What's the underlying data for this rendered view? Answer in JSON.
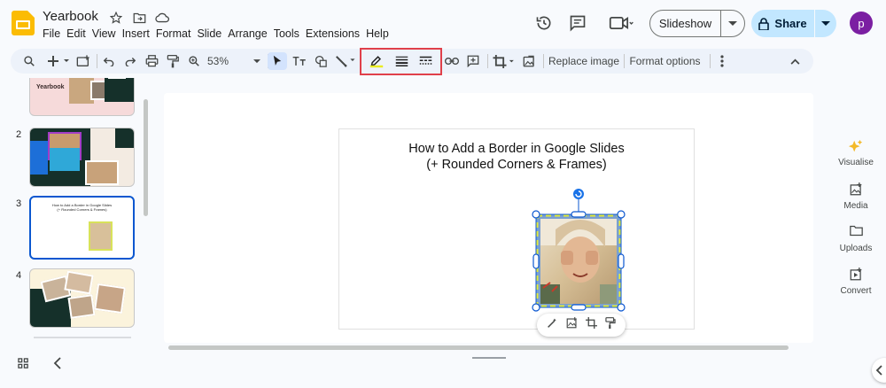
{
  "app": {
    "doc_title": "Yearbook",
    "avatar_letter": "p",
    "accent": "#0b57d0",
    "logo_color": "#fbbc04"
  },
  "menu": [
    "File",
    "Edit",
    "View",
    "Insert",
    "Format",
    "Slide",
    "Arrange",
    "Tools",
    "Extensions",
    "Help"
  ],
  "header": {
    "slideshow_label": "Slideshow",
    "share_label": "Share"
  },
  "toolbar": {
    "zoom": "53%",
    "replace_image": "Replace image",
    "format_options": "Format options",
    "icons": [
      "search-icon",
      "plus-icon",
      "new-slide-icon",
      "undo-icon",
      "redo-icon",
      "print-icon",
      "paint-format-icon",
      "zoom-icon",
      "select-icon",
      "text-box-icon",
      "shape-icon",
      "line-icon",
      "border-color-icon",
      "border-weight-icon",
      "border-dash-icon",
      "link-icon",
      "comment-icon",
      "crop-icon",
      "reset-image-icon",
      "more-icon",
      "collapse-icon"
    ]
  },
  "filmstrip": {
    "slides": [
      {
        "num": "",
        "label": "Yearbook"
      },
      {
        "num": "2",
        "label": ""
      },
      {
        "num": "3",
        "label": ""
      },
      {
        "num": "4",
        "label": ""
      }
    ]
  },
  "slide": {
    "title_line1": "How to Add a Border in Google Slides",
    "title_line2": "(+ Rounded Corners & Frames)"
  },
  "side_panel": [
    {
      "label": "Visualise",
      "icon": "sparkle-icon"
    },
    {
      "label": "Media",
      "icon": "media-icon"
    },
    {
      "label": "Uploads",
      "icon": "folder-icon"
    },
    {
      "label": "Convert",
      "icon": "convert-icon"
    }
  ]
}
